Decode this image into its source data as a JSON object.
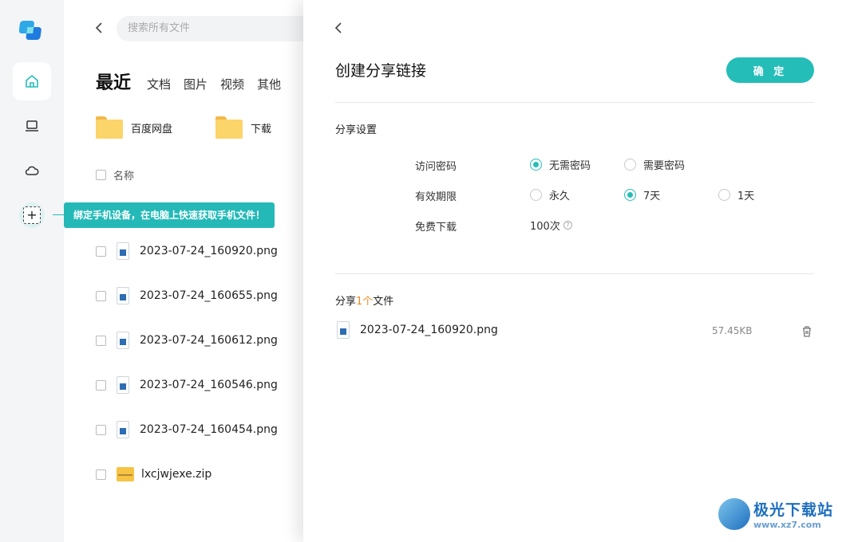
{
  "search": {
    "placeholder": "搜索所有文件"
  },
  "tabs": {
    "recent": "最近",
    "docs": "文档",
    "images": "图片",
    "videos": "视频",
    "other": "其他"
  },
  "folders": [
    "百度网盘",
    "下载"
  ],
  "list_header": "名称",
  "files": [
    "2023-07-24_160920.png",
    "2023-07-24_160655.png",
    "2023-07-24_160612.png",
    "2023-07-24_160546.png",
    "2023-07-24_160454.png",
    "lxcjwjexe.zip"
  ],
  "tooltip": "绑定手机设备，在电脑上快速获取手机文件！",
  "panel": {
    "title": "创建分享链接",
    "confirm_label": "确 定",
    "settings_title": "分享设置",
    "password_label": "访问密码",
    "password_options": [
      "无需密码",
      "需要密码"
    ],
    "password_selected": "无需密码",
    "validity_label": "有效期限",
    "validity_options": [
      "永久",
      "7天",
      "1天"
    ],
    "validity_selected": "7天",
    "download_label": "免费下载",
    "download_value": "100次",
    "share_prefix": "分享",
    "share_count": "1个",
    "share_suffix": "文件",
    "share_file_name": "2023-07-24_160920.png",
    "share_file_size": "57.45KB"
  },
  "watermark": {
    "name": "极光下载站",
    "url": "www.xz7.com"
  },
  "colors": {
    "accent": "#25bdb8",
    "highlight": "#f08a23"
  }
}
